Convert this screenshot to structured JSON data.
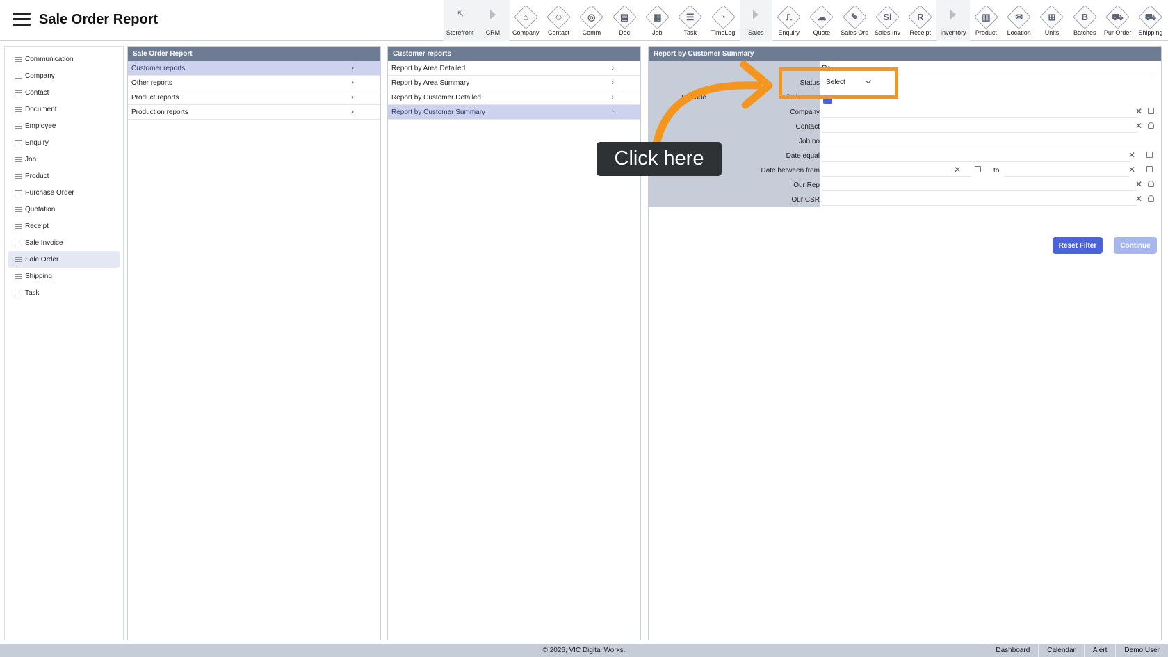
{
  "header": {
    "title": "Sale Order Report",
    "toolbar": [
      {
        "label": "Storefront",
        "icon": "external-link-icon",
        "glyph": "⇱",
        "kind": "plain",
        "section": true
      },
      {
        "label": "CRM",
        "icon": "section-arrow-icon",
        "kind": "arrow",
        "section": true
      },
      {
        "label": "Company",
        "icon": "company-icon",
        "glyph": "⌂",
        "kind": "diamond"
      },
      {
        "label": "Contact",
        "icon": "contact-icon",
        "glyph": "☺",
        "kind": "diamond"
      },
      {
        "label": "Comm",
        "icon": "comm-icon",
        "glyph": "◎",
        "kind": "diamond"
      },
      {
        "label": "Doc",
        "icon": "doc-icon",
        "glyph": "▤",
        "kind": "diamond"
      },
      {
        "label": "Job",
        "icon": "job-icon",
        "glyph": "▦",
        "kind": "diamond"
      },
      {
        "label": "Task",
        "icon": "task-icon",
        "glyph": "☰",
        "kind": "diamond"
      },
      {
        "label": "TimeLog",
        "icon": "clock-icon",
        "glyph": "◔",
        "kind": "diamond"
      },
      {
        "label": "Sales",
        "icon": "section-arrow-icon",
        "kind": "arrow",
        "section": true
      },
      {
        "label": "Enquiry",
        "icon": "enquiry-icon",
        "glyph": "⎍",
        "kind": "diamond"
      },
      {
        "label": "Quote",
        "icon": "quote-icon",
        "glyph": "☁",
        "kind": "diamond"
      },
      {
        "label": "Sales Ord",
        "icon": "sales-order-icon",
        "glyph": "✎",
        "kind": "diamond"
      },
      {
        "label": "Sales Inv",
        "icon": "sales-invoice-icon",
        "glyph": "Si",
        "kind": "diamond"
      },
      {
        "label": "Receipt",
        "icon": "receipt-icon",
        "glyph": "R",
        "kind": "diamond"
      },
      {
        "label": "Inventory",
        "icon": "section-arrow-icon",
        "kind": "arrow",
        "section": true
      },
      {
        "label": "Product",
        "icon": "product-icon",
        "glyph": "▥",
        "kind": "diamond"
      },
      {
        "label": "Location",
        "icon": "location-icon",
        "glyph": "✉",
        "kind": "diamond"
      },
      {
        "label": "Units",
        "icon": "units-icon",
        "glyph": "⊞",
        "kind": "diamond"
      },
      {
        "label": "Batches",
        "icon": "batches-icon",
        "glyph": "B",
        "kind": "diamond"
      },
      {
        "label": "Pur Order",
        "icon": "cart-icon",
        "glyph": "⛟",
        "kind": "diamond"
      },
      {
        "label": "Shipping",
        "icon": "truck-icon",
        "glyph": "⛟",
        "kind": "diamond"
      }
    ]
  },
  "sidebar": {
    "items": [
      {
        "label": "Communication",
        "active": false
      },
      {
        "label": "Company",
        "active": false
      },
      {
        "label": "Contact",
        "active": false
      },
      {
        "label": "Document",
        "active": false
      },
      {
        "label": "Employee",
        "active": false
      },
      {
        "label": "Enquiry",
        "active": false
      },
      {
        "label": "Job",
        "active": false
      },
      {
        "label": "Product",
        "active": false
      },
      {
        "label": "Purchase Order",
        "active": false
      },
      {
        "label": "Quotation",
        "active": false
      },
      {
        "label": "Receipt",
        "active": false
      },
      {
        "label": "Sale Invoice",
        "active": false
      },
      {
        "label": "Sale Order",
        "active": true
      },
      {
        "label": "Shipping",
        "active": false
      },
      {
        "label": "Task",
        "active": false
      }
    ]
  },
  "panel1": {
    "title": "Sale Order Report",
    "items": [
      {
        "label": "Customer reports",
        "active": true
      },
      {
        "label": "Other reports",
        "active": false
      },
      {
        "label": "Product reports",
        "active": false
      },
      {
        "label": "Production reports",
        "active": false
      }
    ]
  },
  "panel2": {
    "title": "Customer reports",
    "items": [
      {
        "label": "Report by Area Detailed",
        "active": false
      },
      {
        "label": "Report by Area Summary",
        "active": false
      },
      {
        "label": "Report by Customer Detailed",
        "active": false
      },
      {
        "label": "Report by Customer Summary",
        "active": true
      }
    ]
  },
  "panel3": {
    "title": "Report by Customer Summary",
    "form": {
      "report_heading_label": "Re",
      "status_label": "Status",
      "status_value": "Select",
      "exclude_label": "Exclude",
      "exclude_suffix_label": "celled",
      "company_label": "Company",
      "contact_label": "Contact",
      "job_no_label": "Job no",
      "date_equal_label": "Date equal",
      "date_between_label": "Date between from",
      "to_label": "to",
      "our_rep_label": "Our Rep",
      "our_csr_label": "Our CSR"
    },
    "reset_label": "Reset Filter",
    "continue_label": "Continue"
  },
  "overlay": {
    "tooltip": "Click here",
    "accent_color": "#f4961e"
  },
  "footer": {
    "copyright": "© 2026, VIC Digital Works.",
    "links": [
      "Dashboard",
      "Calendar",
      "Alert",
      "Demo User"
    ]
  }
}
